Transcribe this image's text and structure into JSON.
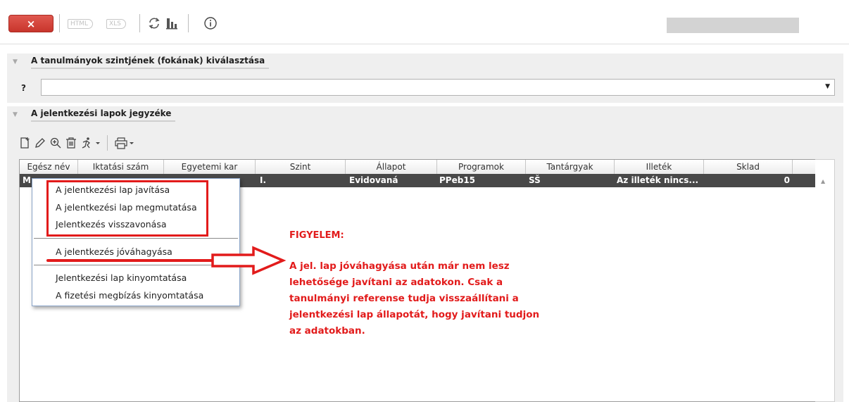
{
  "toolbar": {
    "close_label": "×",
    "html_label": "HTML",
    "xls_label": "XLS",
    "icons": [
      "refresh-icon",
      "org-chart-icon",
      "info-icon"
    ]
  },
  "section_level": {
    "title": "A tanulmányok szintjének (fokának) kiválasztása",
    "field_label": "?",
    "selected_value": ""
  },
  "section_list": {
    "title": "A jelentkezési lapok jegyzéke",
    "icons": [
      "new-document-icon",
      "edit-pencil-icon",
      "zoom-icon",
      "delete-trash-icon",
      "run-action-icon",
      "print-icon"
    ]
  },
  "table": {
    "columns": [
      "Egész név",
      "Iktatási szám",
      "Egyetemi kar",
      "Szint",
      "Állapot",
      "Programok",
      "Tantárgyak",
      "Illeték",
      "Sklad"
    ],
    "rows": [
      {
        "name": "M",
        "reg_no": "",
        "faculty": "",
        "level": "I.",
        "status": "Evidovaná",
        "programs": "PPeb15",
        "subjects": "SŠ",
        "fee": "Az illeték nincs...",
        "sklad": "0"
      }
    ]
  },
  "context_menu": {
    "items": [
      "A jelentkezési lap javítása",
      "A jelentkezési lap megmutatása",
      "Jelentkezés visszavonása",
      "A jelentkezés jóváhagyása",
      "Jelentkezési lap kinyomtatása",
      "A fizetési megbízás kinyomtatása"
    ]
  },
  "annotation": {
    "heading": "FIGYELEM:",
    "lines": [
      "A jel. lap jóváhagyása után már nem lesz",
      "lehetősége javítani az adatokon. Csak a",
      "tanulmányi referense tudja visszaállítani a",
      "jelentkezési lap állapotát, hogy javítani tudjon",
      "az adatokban."
    ],
    "color": "#e21b1b"
  }
}
